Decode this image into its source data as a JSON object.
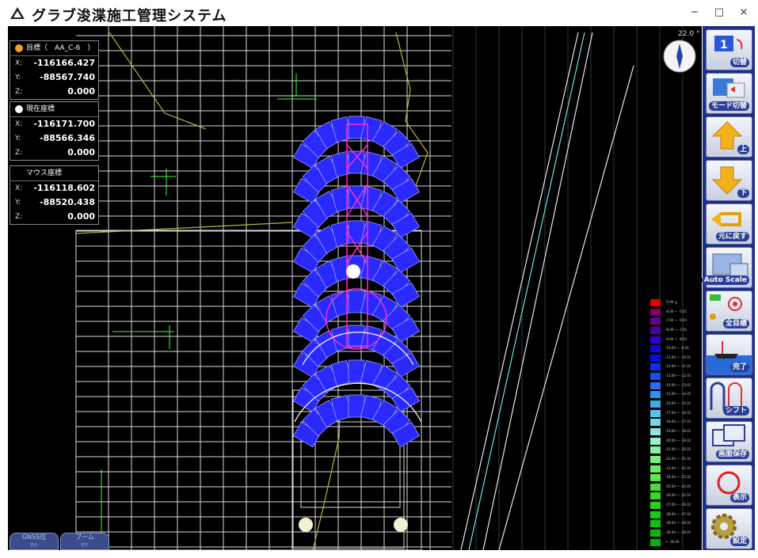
{
  "window": {
    "title": "グラブ浚渫施工管理システム",
    "min_label": "−",
    "max_label": "□",
    "close_label": "×"
  },
  "panels": {
    "target": {
      "label": "目標（　AA_C-6　）",
      "x": "-116166.427",
      "y": "-88567.740",
      "z": "0.000"
    },
    "current": {
      "label": "現在座標",
      "x": "-116171.700",
      "y": "-88566.346",
      "z": "0.000"
    },
    "mouse": {
      "label": "マウス座標",
      "x": "-116118.602",
      "y": "-88520.438",
      "z": "0.000"
    },
    "axis_x": "X:",
    "axis_y": "Y:",
    "axis_z": "Z:"
  },
  "compass": {
    "readout": "22.0 °"
  },
  "legend": [
    {
      "color": "#e00000",
      "text": "-5.00 ≦"
    },
    {
      "color": "#800066",
      "text": "-6.00 ～ -5.01"
    },
    {
      "color": "#6a0080",
      "text": "-7.00 ～ -6.01"
    },
    {
      "color": "#4c00a8",
      "text": "-8.00 ～ -7.01"
    },
    {
      "color": "#3300c8",
      "text": "-9.00 ～ -8.01"
    },
    {
      "color": "#1a00e0",
      "text": "-10.00 ～ -9.01"
    },
    {
      "color": "#0010f0",
      "text": "-11.00 ～ -10.01"
    },
    {
      "color": "#0a30f4",
      "text": "-12.00 ～ -11.01"
    },
    {
      "color": "#1650f0",
      "text": "-13.00 ～ -12.01"
    },
    {
      "color": "#2470ee",
      "text": "-14.00 ～ -13.01"
    },
    {
      "color": "#3090ec",
      "text": "-15.00 ～ -14.01"
    },
    {
      "color": "#40aaf0",
      "text": "-16.00 ～ -15.01"
    },
    {
      "color": "#58c4f0",
      "text": "-17.00 ～ -16.01"
    },
    {
      "color": "#70d8ee",
      "text": "-18.00 ～ -17.01"
    },
    {
      "color": "#88e8e0",
      "text": "-19.00 ～ -18.01"
    },
    {
      "color": "#98f0c8",
      "text": "-20.00 ～ -19.01"
    },
    {
      "color": "#88f0a0",
      "text": "-21.00 ～ -20.01"
    },
    {
      "color": "#78f080",
      "text": "-22.00 ～ -21.01"
    },
    {
      "color": "#68ec60",
      "text": "-23.00 ～ -22.01"
    },
    {
      "color": "#58e848",
      "text": "-24.00 ～ -23.01"
    },
    {
      "color": "#48e038",
      "text": "-25.00 ～ -24.01"
    },
    {
      "color": "#38d828",
      "text": "-26.00 ～ -25.01"
    },
    {
      "color": "#28d020",
      "text": "-27.00 ～ -26.01"
    },
    {
      "color": "#1cc818",
      "text": "-28.00 ～ -27.01"
    },
    {
      "color": "#12c012",
      "text": "-29.00 ～ -28.01"
    },
    {
      "color": "#0cb80c",
      "text": "-30.00 ～ -29.01"
    },
    {
      "color": "#08b008",
      "text": "< -30.00"
    }
  ],
  "bottom_tabs": [
    {
      "label": "GNSS位",
      "sub": "表示"
    },
    {
      "label": "ブーム",
      "sub": "表示"
    }
  ],
  "toolbar": [
    {
      "label": "切替",
      "icon": "screen-1-switch-icon"
    },
    {
      "label": "モード切替",
      "icon": "mode-switch-icon"
    },
    {
      "label": "上",
      "icon": "arrow-up-icon"
    },
    {
      "label": "下",
      "icon": "arrow-down-icon"
    },
    {
      "label": "元に戻す",
      "icon": "undo-icon"
    },
    {
      "label": "Auto Scale",
      "icon": "auto-scale-icon"
    },
    {
      "label": "全目標",
      "icon": "all-targets-icon"
    },
    {
      "label": "完了",
      "icon": "complete-icon"
    },
    {
      "label": "シフト",
      "icon": "shift-icon"
    },
    {
      "label": "画面保存",
      "icon": "screen-save-icon"
    },
    {
      "label": "表示",
      "icon": "display-icon"
    },
    {
      "label": "設定",
      "icon": "settings-gear-icon"
    }
  ],
  "colors": {
    "background": "#000000",
    "grid": "#d8d8d8",
    "cell_fill": "#2a2aff",
    "cell_edge": "#9a9aff",
    "target_path": "#ff2bd8",
    "contour": "#b5b53a",
    "toolbar": "#1e2e80"
  }
}
